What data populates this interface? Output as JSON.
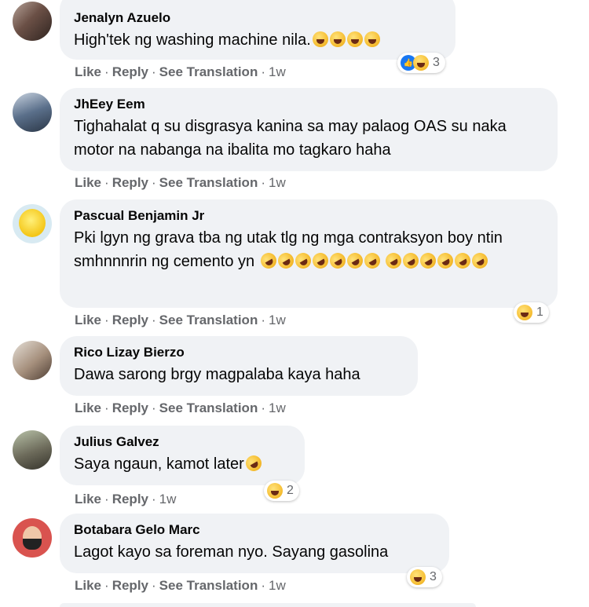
{
  "actions": {
    "like": "Like",
    "reply": "Reply",
    "translate": "See Translation",
    "dot": "·"
  },
  "comments": [
    {
      "author": "Jenalyn Azuelo",
      "text": "High'tek ng washing machine nila.",
      "emoji_icon": "haha-emoji",
      "emoji_count_inline": 4,
      "reactions": [
        "like",
        "haha"
      ],
      "reaction_count": "3",
      "time": "1w",
      "has_translation": true
    },
    {
      "author": "JhEey Eem",
      "text": "Tighahalat q su disgrasya kanina sa may palaog OAS su naka motor na nabanga na ibalita mo tagkaro haha",
      "time": "1w",
      "has_translation": true
    },
    {
      "author": "Pascual Benjamin Jr",
      "text": "Pki lgyn ng grava tba ng utak tlg ng mga contraksyon boy ntin smhnnnrin ng cemento yn",
      "emoji_icon": "rolling-laughing-emoji",
      "emoji_count_inline": 13,
      "reactions": [
        "haha"
      ],
      "reaction_count": "1",
      "time": "1w",
      "has_translation": true
    },
    {
      "author": "Rico Lizay Bierzo",
      "text": "Dawa sarong brgy magpalaba kaya haha",
      "time": "1w",
      "has_translation": true
    },
    {
      "author": "Julius Galvez",
      "text": "Saya ngaun, kamot later",
      "emoji_icon": "rolling-laughing-emoji",
      "emoji_count_inline": 1,
      "reactions": [
        "haha"
      ],
      "reaction_count": "2",
      "time": "1w",
      "has_translation": false
    },
    {
      "author": "Botabara Gelo Marc",
      "text": "Lagot kayo sa foreman nyo. Sayang gasolina",
      "reactions": [
        "haha"
      ],
      "reaction_count": "3",
      "time": "1w",
      "has_translation": true
    }
  ],
  "colors": {
    "bubble": "#f0f2f5",
    "meta": "#65676b",
    "like_blue": "#1877f2"
  }
}
